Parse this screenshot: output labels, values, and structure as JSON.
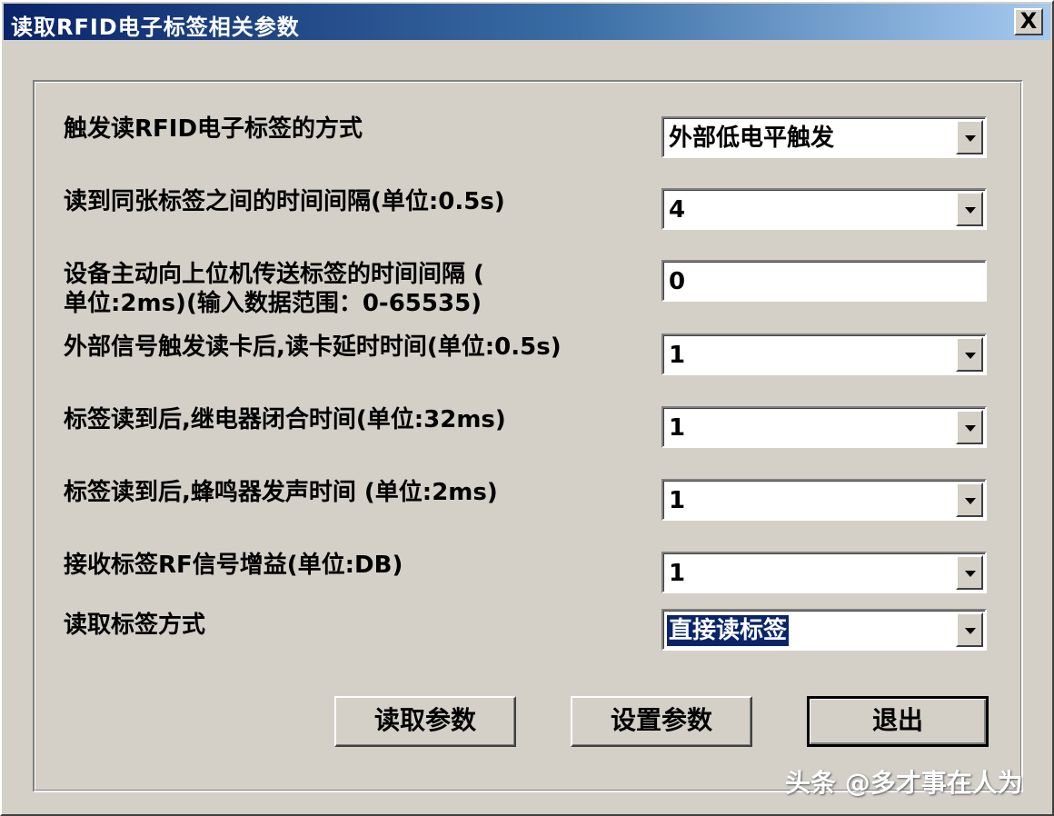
{
  "window": {
    "title": "读取RFID电子标签相关参数",
    "close_label": "X"
  },
  "fields": [
    {
      "label": "触发读RFID电子标签的方式",
      "value": "外部低电平触发",
      "type": "select"
    },
    {
      "label": "读到同张标签之间的时间间隔(单位:0.5s)",
      "value": "4",
      "type": "select"
    },
    {
      "label_line1": "设备主动向上位机传送标签的时间间隔 (",
      "label_line2": "单位:2ms)(输入数据范围：0-65535)",
      "value": "0",
      "type": "input"
    },
    {
      "label": "外部信号触发读卡后,读卡延时时间(单位:0.5s)",
      "value": "1",
      "type": "select"
    },
    {
      "label": "标签读到后,继电器闭合时间(单位:32ms)",
      "value": "1",
      "type": "select"
    },
    {
      "label": "标签读到后,蜂鸣器发声时间 (单位:2ms)",
      "value": "1",
      "type": "select"
    },
    {
      "label": "接收标签RF信号增益(单位:DB)",
      "value": "1",
      "type": "select"
    },
    {
      "label": "读取标签方式",
      "value": "直接读标签",
      "type": "select"
    }
  ],
  "buttons": {
    "read_label": "读取参数",
    "set_label": "设置参数",
    "exit_label": "退出"
  },
  "watermark": "头条 @多才事在人为"
}
